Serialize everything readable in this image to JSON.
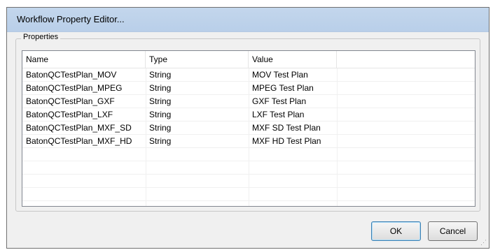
{
  "window": {
    "title": "Workflow Property Editor..."
  },
  "properties_group": {
    "label": "Properties",
    "columns": [
      "Name",
      "Type",
      "Value"
    ],
    "rows": [
      {
        "name": "BatonQCTestPlan_MOV",
        "type": "String",
        "value": "MOV Test Plan"
      },
      {
        "name": "BatonQCTestPlan_MPEG",
        "type": "String",
        "value": "MPEG Test Plan"
      },
      {
        "name": "BatonQCTestPlan_GXF",
        "type": "String",
        "value": "GXF Test Plan"
      },
      {
        "name": "BatonQCTestPlan_LXF",
        "type": "String",
        "value": "LXF Test Plan"
      },
      {
        "name": "BatonQCTestPlan_MXF_SD",
        "type": "String",
        "value": "MXF SD Test Plan"
      },
      {
        "name": "BatonQCTestPlan_MXF_HD",
        "type": "String",
        "value": "MXF HD Test Plan"
      }
    ]
  },
  "buttons": {
    "ok_label": "OK",
    "cancel_label": "Cancel"
  }
}
